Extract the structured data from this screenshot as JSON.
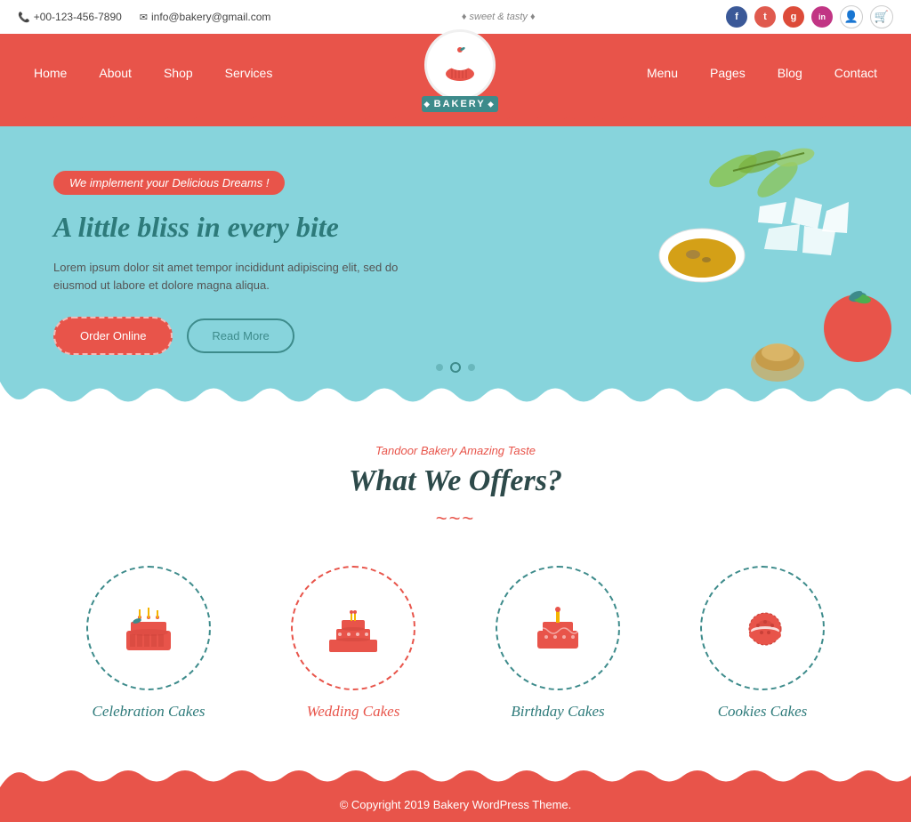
{
  "topbar": {
    "phone": "+00-123-456-7890",
    "phone_icon": "📞",
    "email": "info@bakery@gmail.com",
    "email_icon": "✉",
    "tagline": "♦ sweet & tasty ♦",
    "social": [
      {
        "name": "facebook",
        "label": "f",
        "class": "fb"
      },
      {
        "name": "twitter",
        "label": "t",
        "class": "tw"
      },
      {
        "name": "google",
        "label": "g",
        "class": "gp"
      },
      {
        "name": "instagram",
        "label": "in",
        "class": "ig"
      }
    ]
  },
  "nav": {
    "left": [
      "Home",
      "About",
      "Shop",
      "Services"
    ],
    "right": [
      "Menu",
      "Pages",
      "Blog",
      "Contact"
    ],
    "logo_text": "BAKERY"
  },
  "hero": {
    "badge": "We implement your Delicious Dreams !",
    "title": "A little bliss in every bite",
    "description": "Lorem ipsum dolor sit amet tempor incididunt adipiscing elit, sed do eiusmod ut labore et dolore magna aliqua.",
    "btn_order": "Order Online",
    "btn_read": "Read More"
  },
  "offers": {
    "subtitle": "Tandoor Bakery Amazing Taste",
    "title": "What We Offers?",
    "products": [
      {
        "name": "Celebration Cakes",
        "icon": "🎂",
        "active": false
      },
      {
        "name": "Wedding Cakes",
        "icon": "🎂",
        "active": true
      },
      {
        "name": "Birthday Cakes",
        "icon": "🎂",
        "active": false
      },
      {
        "name": "Cookies Cakes",
        "icon": "🍪",
        "active": false
      }
    ]
  },
  "footer": {
    "text": "© Copyright 2019 Bakery WordPress Theme."
  }
}
